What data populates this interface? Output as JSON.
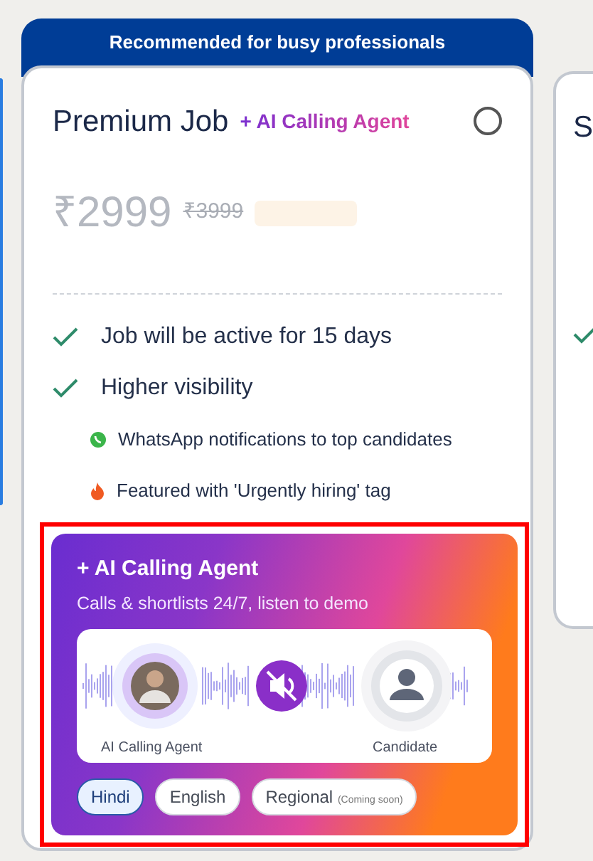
{
  "banner": {
    "text": "Recommended for busy professionals"
  },
  "plan": {
    "title": "Premium Job",
    "addon": "+ AI Calling Agent",
    "selected": false,
    "price": "₹2999",
    "original_price": "₹3999",
    "features": [
      {
        "kind": "check",
        "text": "Job will be active for 15 days"
      },
      {
        "kind": "check",
        "text": "Higher visibility"
      },
      {
        "kind": "whatsapp",
        "text": "WhatsApp notifications to top candidates"
      },
      {
        "kind": "fire",
        "text": "Featured with 'Urgently hiring' tag"
      }
    ],
    "ai_agent": {
      "title": "+ AI Calling Agent",
      "subtitle": "Calls & shortlists 24/7, listen to demo",
      "agent_label": "AI Calling Agent",
      "candidate_label": "Candidate",
      "muted": true,
      "languages": [
        {
          "label": "Hindi",
          "selected": true
        },
        {
          "label": "English",
          "selected": false
        },
        {
          "label": "Regional",
          "note": "(Coming soon)",
          "selected": false
        }
      ]
    }
  },
  "next_plan": {
    "title": "S"
  }
}
